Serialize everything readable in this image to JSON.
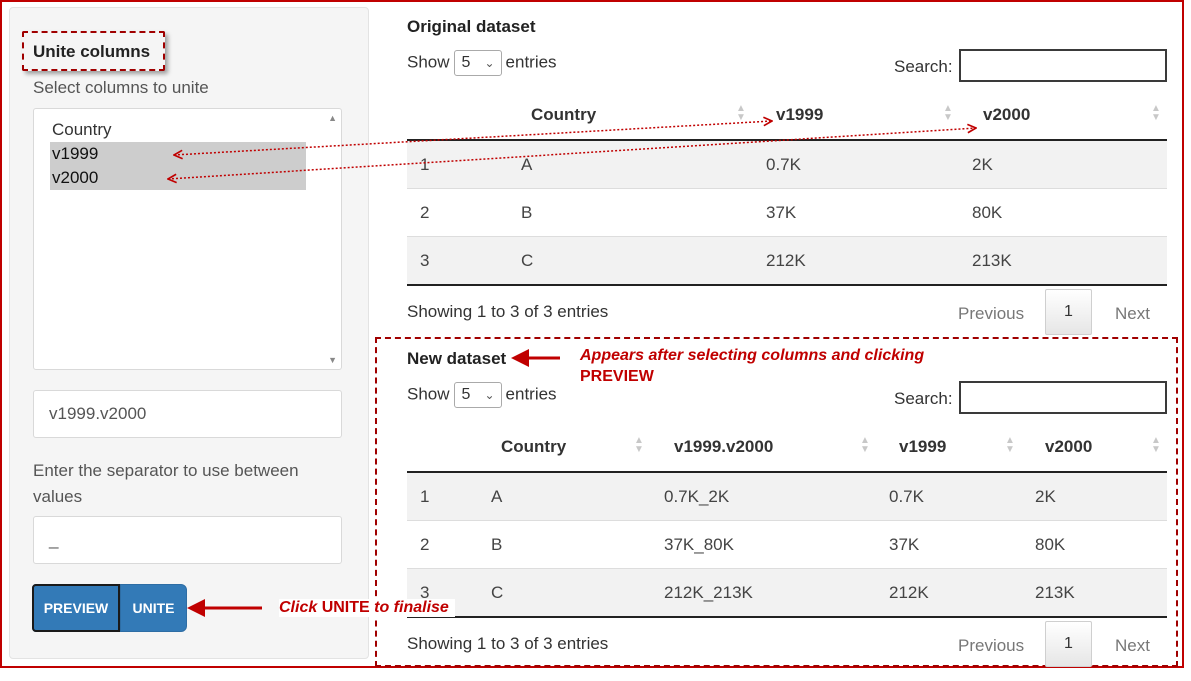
{
  "sidebar": {
    "title": "Unite columns",
    "select_label": "Select columns to unite",
    "options": [
      "Country",
      "v1999",
      "v2000"
    ],
    "selected": [
      "v1999",
      "v2000"
    ],
    "new_col_value": "v1999.v2000",
    "separator_label_line1": "Enter the separator to use between",
    "separator_label_line2": "values",
    "separator_value": "_",
    "preview_label": "PREVIEW",
    "unite_label": "UNITE"
  },
  "original": {
    "title": "Original dataset",
    "show": "Show",
    "entries_count": "5",
    "entries": "entries",
    "search_label": "Search:",
    "columns": [
      "",
      "Country",
      "v1999",
      "v2000"
    ],
    "rows": [
      [
        "1",
        "A",
        "0.7K",
        "2K"
      ],
      [
        "2",
        "B",
        "37K",
        "80K"
      ],
      [
        "3",
        "C",
        "212K",
        "213K"
      ]
    ],
    "info": "Showing 1 to 3 of 3 entries",
    "prev": "Previous",
    "page": "1",
    "next": "Next"
  },
  "new": {
    "title": "New dataset",
    "show": "Show",
    "entries_count": "5",
    "entries": "entries",
    "search_label": "Search:",
    "columns": [
      "",
      "Country",
      "v1999.v2000",
      "v1999",
      "v2000"
    ],
    "rows": [
      [
        "1",
        "A",
        "0.7K_2K",
        "0.7K",
        "2K"
      ],
      [
        "2",
        "B",
        "37K_80K",
        "37K",
        "80K"
      ],
      [
        "3",
        "C",
        "212K_213K",
        "212K",
        "213K"
      ]
    ],
    "info": "Showing 1 to 3 of 3 entries",
    "prev": "Previous",
    "page": "1",
    "next": "Next"
  },
  "annotations": {
    "appears_line1": "Appears after selecting columns and clicking",
    "appears_line2": "PREVIEW",
    "click_prefix": "Click ",
    "click_unite": "UNITE",
    "click_suffix": " to finalise"
  },
  "colors": {
    "accent_red": "#c00000",
    "button_blue": "#337ab7",
    "selected_gray": "#cdcdcd"
  }
}
